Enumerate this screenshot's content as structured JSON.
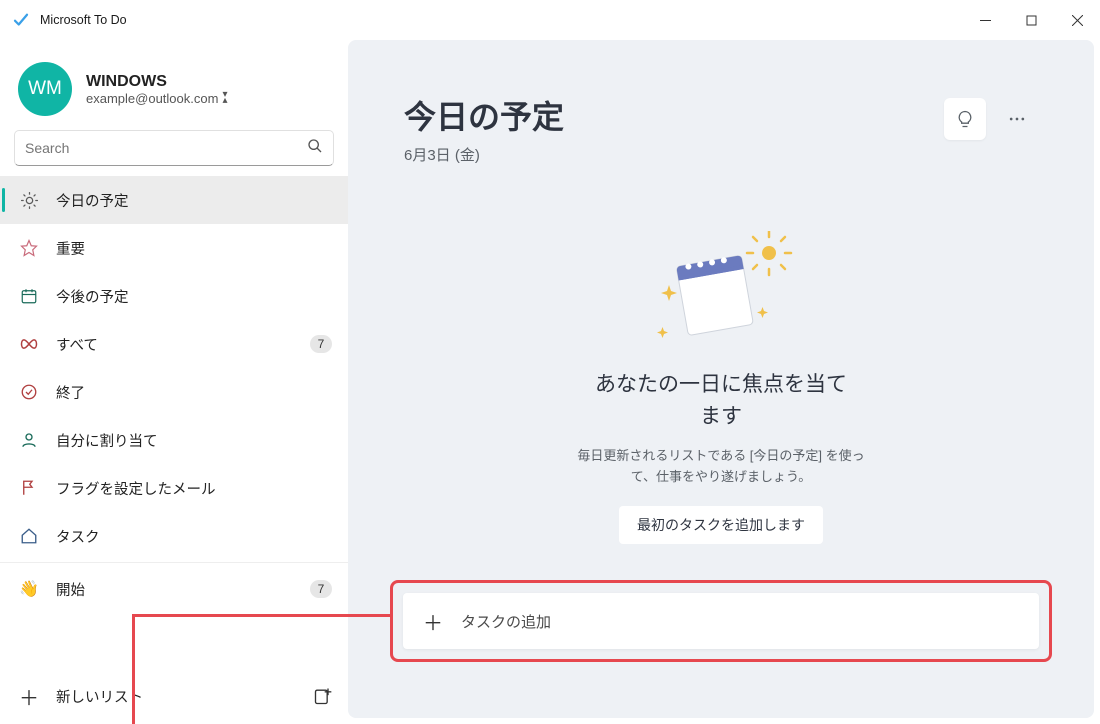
{
  "titlebar": {
    "app_title": "Microsoft To Do"
  },
  "profile": {
    "initials": "WM",
    "name": "WINDOWS",
    "email": "example@outlook.com"
  },
  "search": {
    "placeholder": "Search"
  },
  "nav": {
    "items": [
      {
        "icon": "sun",
        "label": "今日の予定",
        "badge": "",
        "selected": true
      },
      {
        "icon": "star",
        "label": "重要",
        "badge": ""
      },
      {
        "icon": "calendar",
        "label": "今後の予定",
        "badge": ""
      },
      {
        "icon": "infinity",
        "label": "すべて",
        "badge": "7"
      },
      {
        "icon": "check",
        "label": "終了",
        "badge": ""
      },
      {
        "icon": "person",
        "label": "自分に割り当て",
        "badge": ""
      },
      {
        "icon": "flag",
        "label": "フラグを設定したメール",
        "badge": ""
      },
      {
        "icon": "home",
        "label": "タスク",
        "badge": ""
      }
    ],
    "custom": [
      {
        "icon": "hand",
        "label": "開始",
        "badge": "7"
      }
    ],
    "new_list_label": "新しいリスト"
  },
  "main": {
    "title": "今日の予定",
    "date": "6月3日 (金)",
    "empty_title": "あなたの一日に焦点を当てます",
    "empty_sub": "毎日更新されるリストである [今日の予定] を使って、仕事をやり遂げましょう。",
    "empty_button": "最初のタスクを追加します",
    "add_task_label": "タスクの追加"
  }
}
